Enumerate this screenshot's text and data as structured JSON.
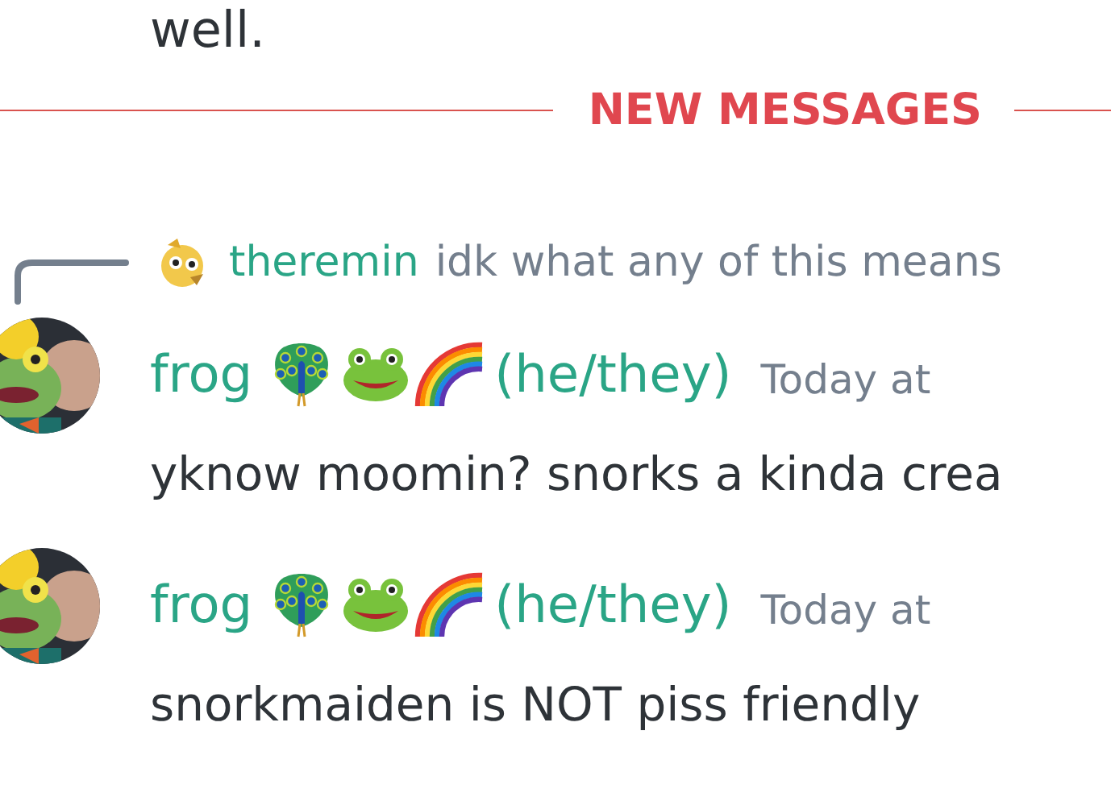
{
  "previous_message_tail": "well.",
  "divider": {
    "label": "NEW MESSAGES"
  },
  "messages": [
    {
      "reply": {
        "author": "theremin",
        "text": "idk what any of this means"
      },
      "author": "frog",
      "pronouns": "(he/they)",
      "timestamp": "Today at",
      "text": "yknow moomin? snorks a kinda crea"
    },
    {
      "author": "frog",
      "pronouns": "(he/they)",
      "timestamp": "Today at",
      "text": "snorkmaiden is NOT piss friendly"
    }
  ]
}
